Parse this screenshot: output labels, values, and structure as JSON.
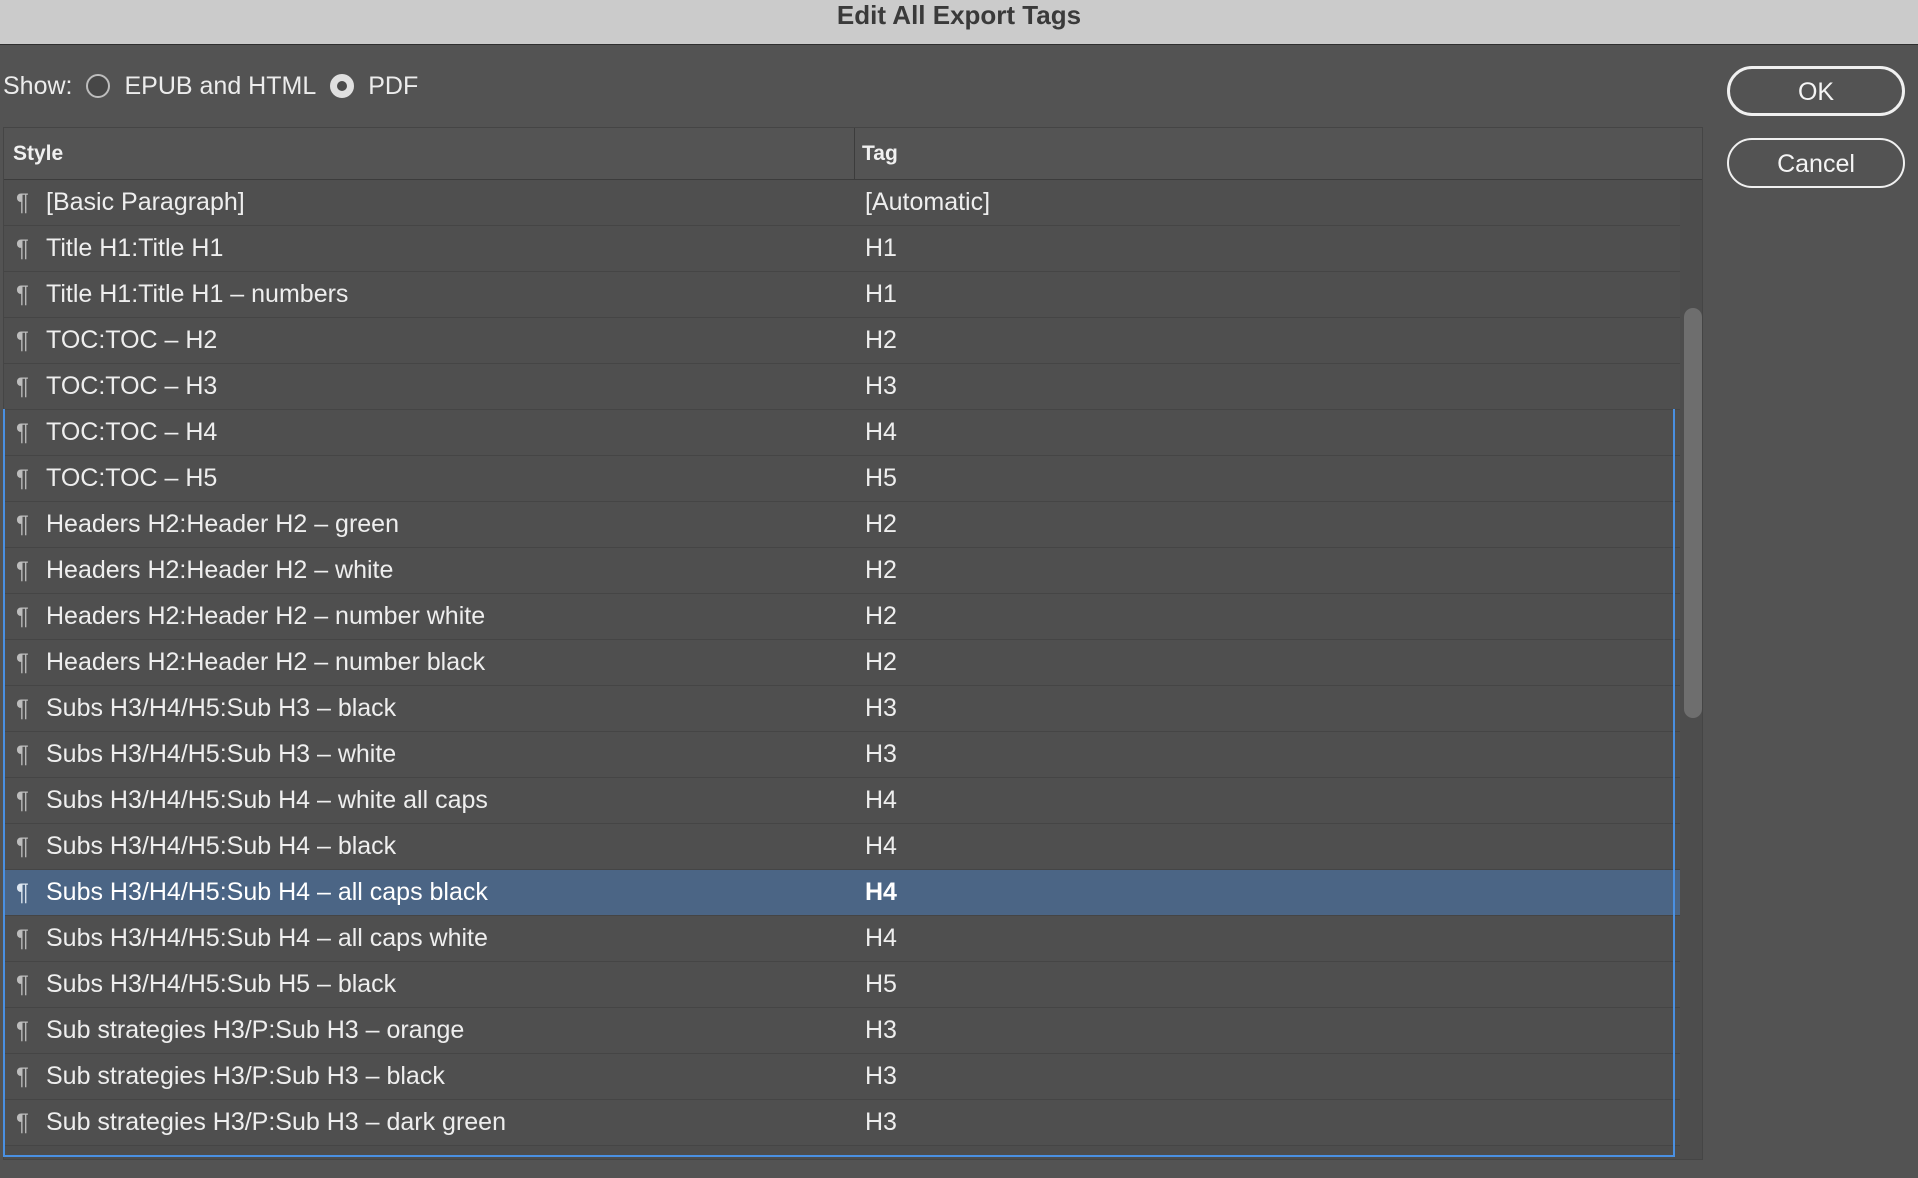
{
  "window": {
    "title": "Edit All Export Tags"
  },
  "show": {
    "label": "Show:",
    "options": [
      {
        "label": "EPUB and HTML",
        "selected": false
      },
      {
        "label": "PDF",
        "selected": true
      }
    ]
  },
  "table": {
    "columns": {
      "style": "Style",
      "tag": "Tag"
    },
    "rows": [
      {
        "style": "[Basic Paragraph]",
        "tag": "[Automatic]"
      },
      {
        "style": "Title H1:Title H1",
        "tag": "H1"
      },
      {
        "style": "Title H1:Title H1 – numbers",
        "tag": "H1"
      },
      {
        "style": "TOC:TOC – H2",
        "tag": "H2"
      },
      {
        "style": "TOC:TOC – H3",
        "tag": "H3"
      },
      {
        "style": "TOC:TOC – H4",
        "tag": "H4"
      },
      {
        "style": "TOC:TOC – H5",
        "tag": "H5"
      },
      {
        "style": "Headers H2:Header H2 – green",
        "tag": "H2"
      },
      {
        "style": "Headers H2:Header H2 – white",
        "tag": "H2"
      },
      {
        "style": "Headers H2:Header H2 – number white",
        "tag": "H2"
      },
      {
        "style": "Headers H2:Header H2 – number black",
        "tag": "H2"
      },
      {
        "style": "Subs H3/H4/H5:Sub H3 – black",
        "tag": "H3"
      },
      {
        "style": "Subs H3/H4/H5:Sub H3 – white",
        "tag": "H3"
      },
      {
        "style": "Subs H3/H4/H5:Sub H4 – white all caps",
        "tag": "H4"
      },
      {
        "style": "Subs H3/H4/H5:Sub H4 – black",
        "tag": "H4"
      },
      {
        "style": "Subs H3/H4/H5:Sub H4 – all caps black",
        "tag": "H4",
        "selected": true
      },
      {
        "style": "Subs H3/H4/H5:Sub H4 – all caps white",
        "tag": "H4"
      },
      {
        "style": "Subs H3/H4/H5:Sub H5 – black",
        "tag": "H5"
      },
      {
        "style": "Sub strategies H3/P:Sub H3 – orange",
        "tag": "H3"
      },
      {
        "style": "Sub strategies H3/P:Sub H3 – black",
        "tag": "H3"
      },
      {
        "style": "Sub strategies H3/P:Sub H3 – dark green",
        "tag": "H3"
      }
    ]
  },
  "buttons": {
    "ok": "OK",
    "cancel": "Cancel"
  },
  "colors": {
    "background": "#535353",
    "titlebar": "#cbcbcb",
    "selected_row": "#4b6585",
    "focus_frame": "#4a90e2"
  }
}
